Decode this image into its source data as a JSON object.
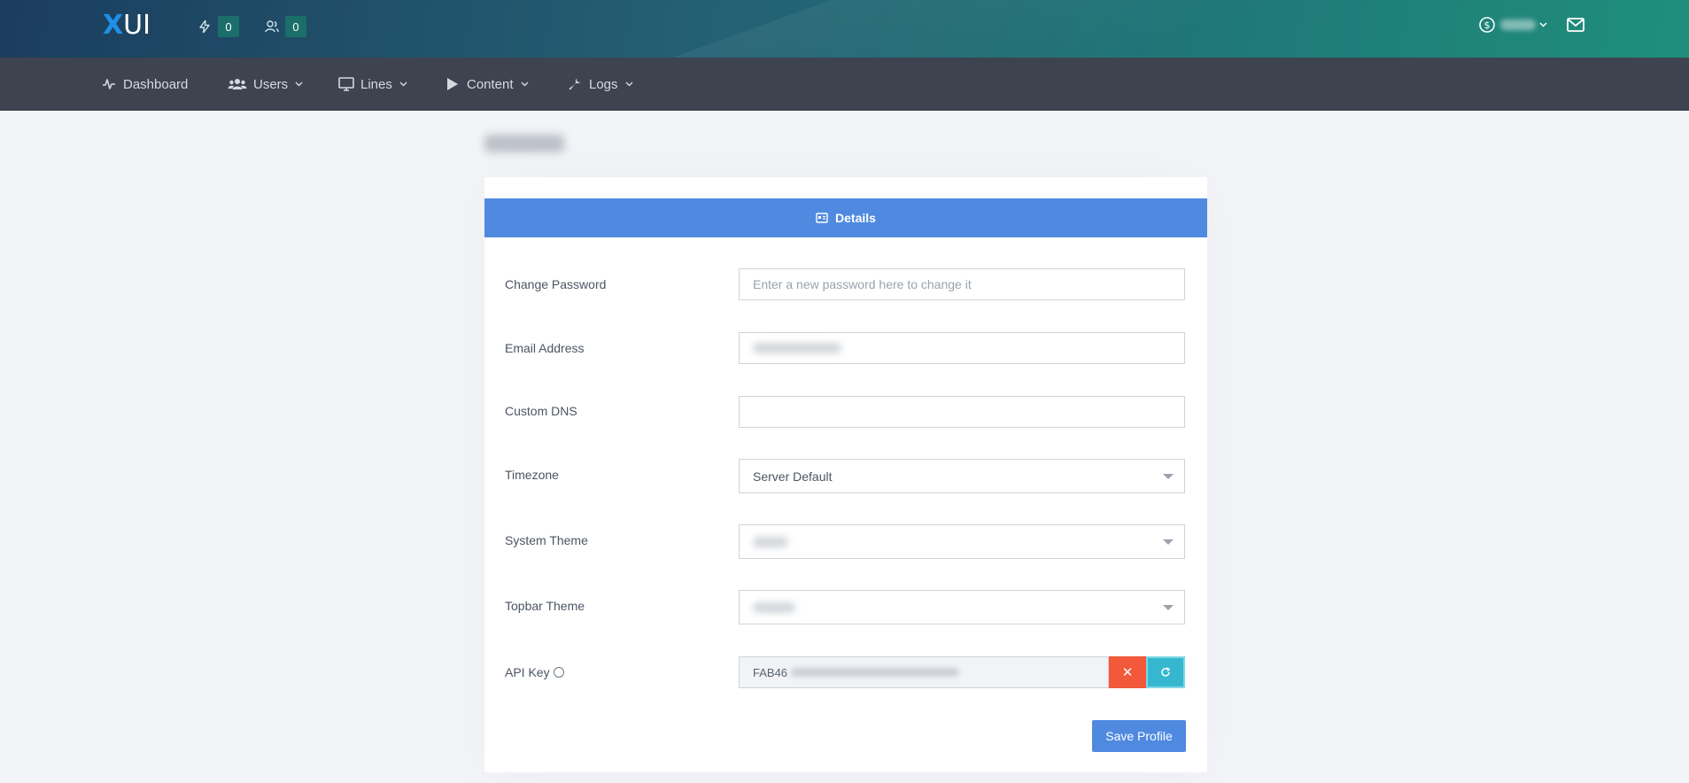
{
  "topbar": {
    "logo_x": "X",
    "logo_ui": "UI",
    "connections_count": "0",
    "users_count": "0",
    "icons": [
      "bolt-icon",
      "users-outline-icon",
      "dollar-circle-icon",
      "chevron-down-icon",
      "mail-icon"
    ]
  },
  "menu": {
    "items": [
      {
        "label": "Dashboard",
        "icon": "activity-icon"
      },
      {
        "label": "Users",
        "icon": "users-icon"
      },
      {
        "label": "Lines",
        "icon": "monitor-icon"
      },
      {
        "label": "Content",
        "icon": "play-icon"
      },
      {
        "label": "Logs",
        "icon": "wrench-icon"
      }
    ]
  },
  "tab": {
    "label": "Details",
    "icon": "id-card-icon"
  },
  "form": {
    "change_password_label": "Change Password",
    "change_password_placeholder": "Enter a new password here to change it",
    "email_label": "Email Address",
    "custom_dns_label": "Custom DNS",
    "custom_dns_value": "",
    "timezone_label": "Timezone",
    "timezone_value": "Server Default",
    "system_theme_label": "System Theme",
    "topbar_theme_label": "Topbar Theme",
    "api_key_label": "API Key",
    "api_key_prefix": "FAB46",
    "clear_symbol": "✕",
    "refresh_symbol": "↻",
    "save_label": "Save Profile"
  },
  "colors": {
    "accent": "#4f8ae0",
    "danger": "#f1593a",
    "info": "#35b8cf",
    "menubar": "#3d4450"
  }
}
